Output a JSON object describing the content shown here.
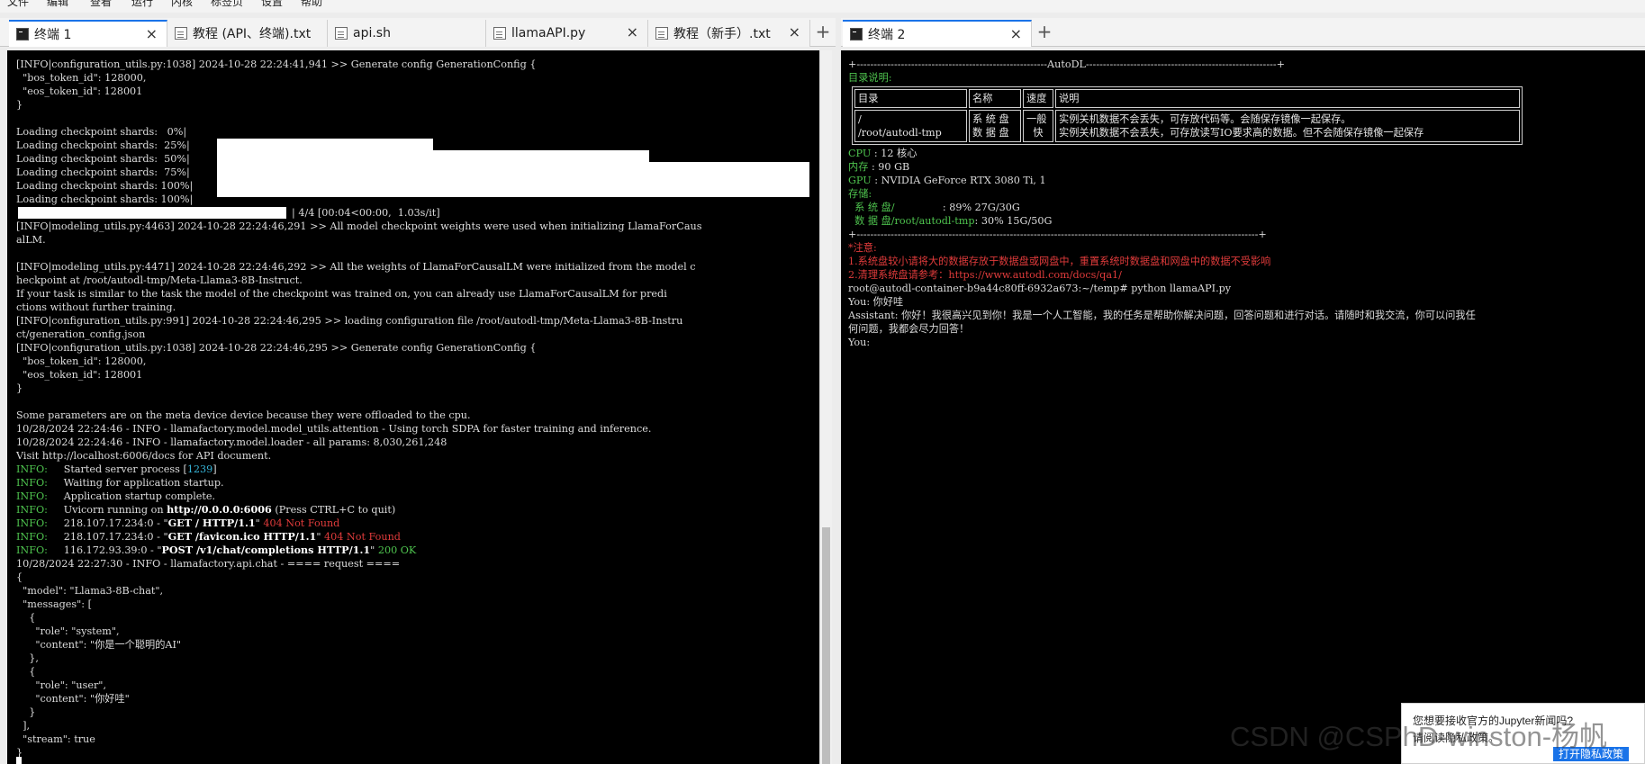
{
  "menu": [
    "文件",
    "编辑",
    "查看",
    "运行",
    "内核",
    "标签页",
    "设置",
    "帮助"
  ],
  "left_tabs": [
    {
      "label": "终端 1",
      "icon": "terminal-icon"
    },
    {
      "label": "教程 (API、终端).txt",
      "icon": "file-icon"
    },
    {
      "label": "api.sh",
      "icon": "file-icon"
    },
    {
      "label": "llamaAPI.py",
      "icon": "file-icon"
    },
    {
      "label": "教程（新手）.txt",
      "icon": "file-icon"
    }
  ],
  "right_tabs": [
    {
      "label": "终端 2",
      "icon": "terminal-icon"
    }
  ],
  "add_tab_label": "+",
  "close_label": "×",
  "terminal1": {
    "l01": "[INFO|configuration_utils.py:1038] 2024-10-28 22:24:41,941 >> Generate config GenerationConfig {",
    "l02": "  \"bos_token_id\": 128000,",
    "l03": "  \"eos_token_id\": 128001",
    "l04": "}",
    "l05": "",
    "l06": "Loading checkpoint shards:   0%|",
    "l07": "Loading checkpoint shards:  25%|",
    "l08": "Loading checkpoint shards:  50%|",
    "l09": "Loading checkpoint shards:  75%|",
    "l10": "Loading checkpoint shards: 100%|",
    "l11": "Loading checkpoint shards: 100%|",
    "l12": "| 4/4 [00:04<00:00,  1.03s/it]",
    "l13": "[INFO|modeling_utils.py:4463] 2024-10-28 22:24:46,291 >> All model checkpoint weights were used when initializing LlamaForCaus",
    "l14": "alLM.",
    "l15": "",
    "l16": "[INFO|modeling_utils.py:4471] 2024-10-28 22:24:46,292 >> All the weights of LlamaForCausalLM were initialized from the model c",
    "l17": "heckpoint at /root/autodl-tmp/Meta-Llama3-8B-Instruct.",
    "l18": "If your task is similar to the task the model of the checkpoint was trained on, you can already use LlamaForCausalLM for predi",
    "l19": "ctions without further training.",
    "l20": "[INFO|configuration_utils.py:991] 2024-10-28 22:24:46,295 >> loading configuration file /root/autodl-tmp/Meta-Llama3-8B-Instru",
    "l21": "ct/generation_config.json",
    "l22": "[INFO|configuration_utils.py:1038] 2024-10-28 22:24:46,295 >> Generate config GenerationConfig {",
    "l23": "  \"bos_token_id\": 128000,",
    "l24": "  \"eos_token_id\": 128001",
    "l25": "}",
    "l26": "",
    "l27": "Some parameters are on the meta device device because they were offloaded to the cpu.",
    "l28": "10/28/2024 22:24:46 - INFO - llamafactory.model.model_utils.attention - Using torch SDPA for faster training and inference.",
    "l29": "10/28/2024 22:24:46 - INFO - llamafactory.model.loader - all params: 8,030,261,248",
    "l30": "Visit http://localhost:6006/docs for API document.",
    "info": "INFO:",
    "l31a": "     Started server process [",
    "l31b": "1239",
    "l31c": "]",
    "l32": "     Waiting for application startup.",
    "l33": "     Application startup complete.",
    "l34a": "     Uvicorn running on ",
    "l34b": "http://0.0.0.0:6006",
    "l34c": " (Press CTRL+C to quit)",
    "l35a": "     218.107.17.234:0 - \"",
    "l35b": "GET / HTTP/1.1",
    "l35c": "\" ",
    "l35d": "404 Not Found",
    "l36a": "     218.107.17.234:0 - \"",
    "l36b": "GET /favicon.ico HTTP/1.1",
    "l36c": "\" ",
    "l36d": "404 Not Found",
    "l37a": "     116.172.93.39:0 - \"",
    "l37b": "POST /v1/chat/completions HTTP/1.1",
    "l37c": "\" ",
    "l37d": "200 OK",
    "l38": "10/28/2024 22:27:30 - INFO - llamafactory.api.chat - ==== request ====",
    "l39": "{",
    "l40": "  \"model\": \"Llama3-8B-chat\",",
    "l41": "  \"messages\": [",
    "l42": "    {",
    "l43": "      \"role\": \"system\",",
    "l44": "      \"content\": \"你是一个聪明的AI\"",
    "l45": "    },",
    "l46": "    {",
    "l47": "      \"role\": \"user\",",
    "l48": "      \"content\": \"你好哇\"",
    "l49": "    }",
    "l50": "  ],",
    "l51": "  \"stream\": true",
    "l52": "}"
  },
  "terminal2": {
    "sep_top": "+--------------------------------------------------------AutoDL--------------------------------------------------------+",
    "dir_title": "目录说明:",
    "table_headers": [
      "目录",
      "名称",
      "速度",
      "说明"
    ],
    "row_dir": [
      "/",
      "/root/autodl-tmp"
    ],
    "row_name": [
      "系 统 盘",
      "数 据 盘"
    ],
    "row_speed": [
      "一般",
      "快"
    ],
    "row_desc": [
      "实例关机数据不会丢失，可存放代码等。会随保存镜像一起保存。",
      "实例关机数据不会丢失，可存放读写IO要求高的数据。但不会随保存镜像一起保存"
    ],
    "cpu_label": "CPU",
    "cpu_value": " : 12 核心",
    "mem_label": "内存",
    "mem_value": " : 90 GB",
    "gpu_label": "GPU",
    "gpu_value": " : NVIDIA GeForce RTX 3080 Ti, 1",
    "storage_label": "存储:",
    "sys_disk_label": "  系 统 盘/",
    "sys_disk_value": "               : 89% 27G/30G",
    "data_disk_label": "  数 据 盘/root/autodl-tmp",
    "data_disk_value": ": 30% 15G/50G",
    "sep_bottom": "+----------------------------------------------------------------------------------------------------------------------+",
    "note_title": "*注意:",
    "note1": "1.系统盘较小请将大的数据存放于数据盘或网盘中，重置系统时数据盘和网盘中的数据不受影响",
    "note2": "2.清理系统盘请参考：https://www.autodl.com/docs/qa1/",
    "prompt": "root@autodl-container-b9a44c80ff-6932a673:~/temp# python llamaAPI.py",
    "you1": "You: 你好哇",
    "assistant1": "Assistant: 你好！我很高兴见到你！我是一个人工智能，我的任务是帮助你解决问题，回答问题和进行对话。请随时和我交流，你可以问我任",
    "assistant2": "何问题，我都会尽力回答！",
    "you2": "You:"
  },
  "notification": {
    "line1": "您想要接收官方的Jupyter新闻吗?",
    "line2": "请阅读隐私政策。",
    "button": "打开隐私政策"
  },
  "watermark": "CSDN @CSPhD-winston-杨帆",
  "colors": {
    "terminal_bg": "#000000",
    "terminal_fg": "#dcdcdc",
    "info_green": "#4ec34e",
    "error_red": "#e03b3b",
    "pid_cyan": "#36b3d6",
    "tab_accent": "#1a73e8"
  }
}
